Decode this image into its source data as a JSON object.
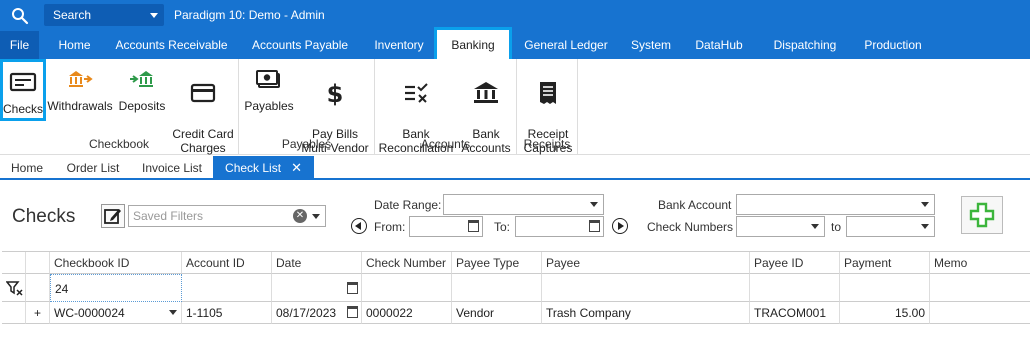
{
  "titlebar": {
    "search_label": "Search",
    "title": "Paradigm 10: Demo - Admin"
  },
  "menu": {
    "file": "File",
    "items": [
      "Home",
      "Accounts Receivable",
      "Accounts Payable",
      "Inventory",
      "Banking",
      "General Ledger",
      "System",
      "DataHub",
      "Dispatching",
      "Production"
    ],
    "active": "Banking"
  },
  "ribbon": {
    "groups": [
      {
        "label": "Checkbook",
        "buttons": [
          "Checks",
          "Withdrawals",
          "Deposits",
          "Credit Card\nCharges"
        ]
      },
      {
        "label": "Payables",
        "buttons": [
          "Payables",
          "Pay Bills\nMulti-Vendor"
        ]
      },
      {
        "label": "Accounts",
        "buttons": [
          "Bank\nReconciliation",
          "Bank\nAccounts"
        ]
      },
      {
        "label": "Receipts",
        "buttons": [
          "Receipt\nCaptures"
        ]
      }
    ],
    "selected": "Checks"
  },
  "doc_tabs": {
    "items": [
      "Home",
      "Order List",
      "Invoice List",
      "Check List"
    ],
    "active": "Check List",
    "close_glyph": "✕"
  },
  "filters": {
    "page_title": "Checks",
    "saved_filters_placeholder": "Saved Filters",
    "date_range_label": "Date Range:",
    "date_range_value": "",
    "from_label": "From:",
    "from_value": "",
    "to_label": "To:",
    "to_value": "",
    "bank_account_label": "Bank Account",
    "bank_account_value": "",
    "check_numbers_label": "Check Numbers",
    "check_numbers_from": "",
    "check_numbers_to_label": "to",
    "check_numbers_to": ""
  },
  "grid": {
    "columns": [
      "Checkbook ID",
      "Account ID",
      "Date",
      "Check Number",
      "Payee Type",
      "Payee",
      "Payee ID",
      "Payment",
      "Memo"
    ],
    "filter_row": {
      "checkbook_id": "24"
    },
    "rows": [
      {
        "expander": "+",
        "checkbook_id": "WC-0000024",
        "account_id": "1-1105",
        "date": "08/17/2023",
        "check_number": "0000022",
        "payee_type": "Vendor",
        "payee": "Trash Company",
        "payee_id": "TRACOM001",
        "payment": "15.00",
        "memo": ""
      }
    ]
  },
  "colors": {
    "brand_blue": "#1773d0",
    "dark_blue": "#0e5db4",
    "highlight": "#0aa0ec",
    "add_green": "#3cb53c",
    "deposit_green": "#2e9a4a",
    "withdraw_orange": "#e8891b"
  }
}
